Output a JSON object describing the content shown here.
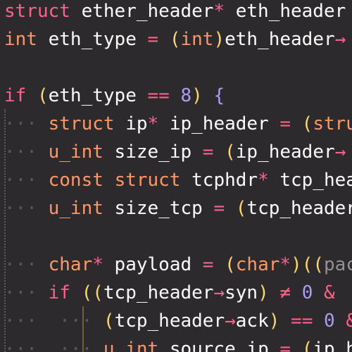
{
  "editor": {
    "colors": {
      "background": "#2d2a2e",
      "keyword": "#ff6188",
      "type": "#fc9867",
      "paren": "#ffd866",
      "brace": "#ab9df2",
      "number": "#ab9df2",
      "plain": "#fcfcfa",
      "indent_guide": "#5b595c"
    },
    "lines": [
      [
        [
          "kw",
          "struct"
        ],
        [
          "pl",
          " ether_header"
        ],
        [
          "op",
          "*"
        ],
        [
          "pl",
          " eth_header "
        ],
        [
          "op",
          "="
        ]
      ],
      [
        [
          "ty",
          "int"
        ],
        [
          "pl",
          " eth_type "
        ],
        [
          "op",
          "="
        ],
        [
          "pl",
          " "
        ],
        [
          "pa",
          "("
        ],
        [
          "ty",
          "int"
        ],
        [
          "pa",
          ")"
        ],
        [
          "pl",
          "eth_header"
        ],
        [
          "op",
          "→"
        ]
      ],
      [],
      [
        [
          "kw",
          "if"
        ],
        [
          "pl",
          " "
        ],
        [
          "pa",
          "("
        ],
        [
          "pl",
          "eth_type "
        ],
        [
          "op",
          "=="
        ],
        [
          "pl",
          " "
        ],
        [
          "nu",
          "8"
        ],
        [
          "pa",
          ")"
        ],
        [
          "pl",
          " "
        ],
        [
          "br",
          "{"
        ]
      ],
      [
        [
          "ws",
          "···"
        ],
        [
          "pl",
          " "
        ],
        [
          "ty",
          "struct"
        ],
        [
          "pl",
          " ip"
        ],
        [
          "op",
          "*"
        ],
        [
          "pl",
          " ip_header "
        ],
        [
          "op",
          "="
        ],
        [
          "pl",
          " "
        ],
        [
          "pa",
          "("
        ],
        [
          "ty",
          "stru"
        ]
      ],
      [
        [
          "ws",
          "···"
        ],
        [
          "pl",
          " "
        ],
        [
          "ty",
          "u_int"
        ],
        [
          "pl",
          " size_ip "
        ],
        [
          "op",
          "="
        ],
        [
          "pl",
          " "
        ],
        [
          "pa",
          "("
        ],
        [
          "pl",
          "ip_header"
        ],
        [
          "op",
          "→"
        ]
      ],
      [
        [
          "ws",
          "···"
        ],
        [
          "pl",
          " "
        ],
        [
          "ty",
          "const"
        ],
        [
          "pl",
          " "
        ],
        [
          "ty",
          "struct"
        ],
        [
          "pl",
          " tcphdr"
        ],
        [
          "op",
          "*"
        ],
        [
          "pl",
          " tcp_hea"
        ]
      ],
      [
        [
          "ws",
          "···"
        ],
        [
          "pl",
          " "
        ],
        [
          "ty",
          "u_int"
        ],
        [
          "pl",
          " size_tcp "
        ],
        [
          "op",
          "="
        ],
        [
          "pl",
          " "
        ],
        [
          "pa",
          "("
        ],
        [
          "pl",
          "tcp_header"
        ]
      ],
      [],
      [
        [
          "ws",
          "···"
        ],
        [
          "pl",
          " "
        ],
        [
          "ty",
          "char"
        ],
        [
          "op",
          "*"
        ],
        [
          "pl",
          " payload "
        ],
        [
          "op",
          "="
        ],
        [
          "pl",
          " "
        ],
        [
          "pa",
          "("
        ],
        [
          "ty",
          "char"
        ],
        [
          "op",
          "*"
        ],
        [
          "pa",
          ")(("
        ],
        [
          "dim",
          "pac"
        ]
      ],
      [
        [
          "ws",
          "···"
        ],
        [
          "pl",
          " "
        ],
        [
          "kw",
          "if"
        ],
        [
          "pl",
          " "
        ],
        [
          "pa",
          "(("
        ],
        [
          "pl",
          "tcp_header"
        ],
        [
          "op",
          "→"
        ],
        [
          "pl",
          "syn"
        ],
        [
          "pa",
          ")"
        ],
        [
          "pl",
          " "
        ],
        [
          "op",
          "≠"
        ],
        [
          "pl",
          " "
        ],
        [
          "nu",
          "0"
        ],
        [
          "pl",
          " "
        ],
        [
          "op",
          "&"
        ]
      ],
      [
        [
          "ws",
          "···"
        ],
        [
          "pl",
          "  "
        ],
        [
          "ws",
          "···"
        ],
        [
          "pl",
          " "
        ],
        [
          "pa",
          "("
        ],
        [
          "pl",
          "tcp_header"
        ],
        [
          "op",
          "→"
        ],
        [
          "pl",
          "ack"
        ],
        [
          "pa",
          ")"
        ],
        [
          "pl",
          " "
        ],
        [
          "op",
          "=="
        ],
        [
          "pl",
          " "
        ],
        [
          "nu",
          "0"
        ],
        [
          "pl",
          " "
        ],
        [
          "op",
          "&"
        ]
      ],
      [
        [
          "ws",
          "···"
        ],
        [
          "pl",
          "  "
        ],
        [
          "ws",
          "···"
        ],
        [
          "pl",
          " "
        ],
        [
          "ty",
          "u_int"
        ],
        [
          "pl",
          " source_ip "
        ],
        [
          "op",
          "="
        ],
        [
          "pl",
          " "
        ],
        [
          "pa",
          "("
        ],
        [
          "pl",
          "ip_he"
        ]
      ]
    ]
  }
}
